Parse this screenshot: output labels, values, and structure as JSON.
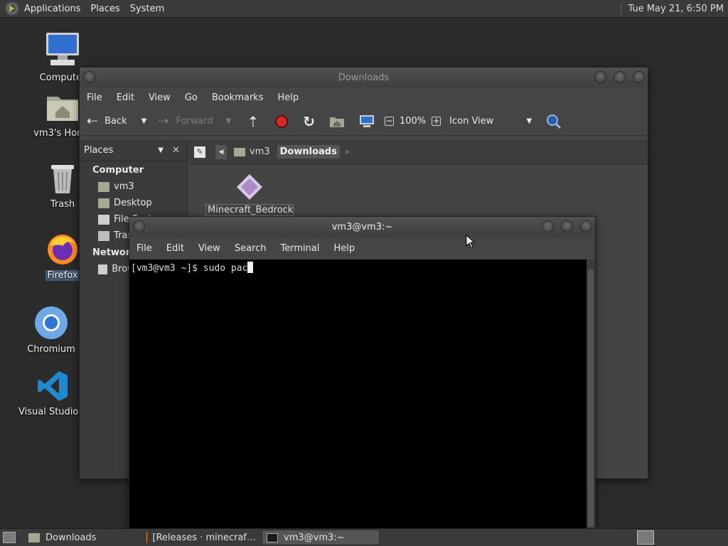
{
  "top_panel": {
    "menus": [
      "Applications",
      "Places",
      "System"
    ],
    "clock": "Tue May 21,  6:50 PM"
  },
  "desktop_icons": [
    {
      "label": "Computer",
      "icon": "computer-icon"
    },
    {
      "label": "vm3's Home",
      "icon": "home-folder-icon"
    },
    {
      "label": "Trash",
      "icon": "trash-icon"
    },
    {
      "label": "Firefox",
      "icon": "firefox-icon"
    },
    {
      "label": "Chromium",
      "icon": "chromium-icon"
    },
    {
      "label": "Visual Studio Code",
      "icon": "vscode-icon"
    }
  ],
  "file_manager": {
    "title": "Downloads",
    "menu": [
      "File",
      "Edit",
      "View",
      "Go",
      "Bookmarks",
      "Help"
    ],
    "toolbar": {
      "back": "Back",
      "forward": "Forward",
      "zoom": "100%",
      "view_mode": "Icon View"
    },
    "sidebar_selector": "Places",
    "path": [
      "vm3",
      "Downloads"
    ],
    "sidebar": {
      "sections": [
        {
          "title": "Computer",
          "items": [
            "vm3",
            "Desktop",
            "File System",
            "Trash"
          ]
        },
        {
          "title": "Network",
          "items": [
            "Browse Network"
          ]
        }
      ]
    },
    "files": [
      {
        "name": "Minecraft_Bedrock_"
      }
    ]
  },
  "terminal": {
    "title": "vm3@vm3:~",
    "menu": [
      "File",
      "Edit",
      "View",
      "Search",
      "Terminal",
      "Help"
    ],
    "prompt": "[vm3@vm3 ~]$ ",
    "input": "sudo pac"
  },
  "taskbar": {
    "tasks": [
      "Downloads",
      "[Releases · minecraf…",
      "vm3@vm3:~"
    ]
  },
  "colors": {
    "panel": "#3a3a3a",
    "desktop": "#2b2b2b",
    "window": "#454545",
    "terminal_bg": "#000000"
  }
}
